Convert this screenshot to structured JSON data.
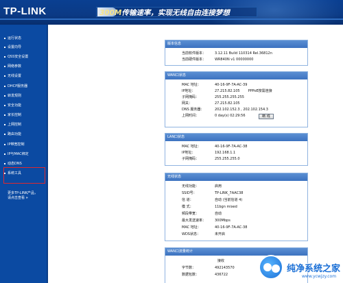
{
  "header": {
    "logo": "TP-LINK",
    "slogan_highlight": "300M",
    "slogan_rest": "传输速率，实现无线自由连接梦想"
  },
  "sidebar": {
    "items": [
      {
        "label": "运行状态"
      },
      {
        "label": "设置向导"
      },
      {
        "label": "QSS安全设置"
      },
      {
        "label": "网络参数"
      },
      {
        "label": "无线设置"
      },
      {
        "label": "DHCP服务器"
      },
      {
        "label": "转发规则"
      },
      {
        "label": "安全功能"
      },
      {
        "label": "家长控制"
      },
      {
        "label": "上网控制"
      },
      {
        "label": "路由功能"
      },
      {
        "label": "IP带宽控制"
      },
      {
        "label": "IP与MAC绑定"
      },
      {
        "label": "动态DNS"
      },
      {
        "label": "系统工具"
      }
    ],
    "more_link_line1": "更多TP-LINK产品，",
    "more_link_line2": "请点击查看",
    "more_link_arrow": "»"
  },
  "panels": {
    "version": {
      "title": "版本信息",
      "rows": [
        {
          "label": "当前软件版本：",
          "value": "3.12.11 Build 110314 Rel.36812n"
        },
        {
          "label": "当前硬件版本：",
          "value": "WR840N v1 00000000"
        }
      ]
    },
    "wan": {
      "title": "WAN口状态",
      "rows": [
        {
          "label": "MAC 地址：",
          "value": "40-16-9F-7A-AC-39",
          "extra": ""
        },
        {
          "label": "IP地址：",
          "value": "27.215.82.105",
          "extra": "PPPoE按需连接"
        },
        {
          "label": "子网掩码：",
          "value": "255.255.255.255",
          "extra": ""
        },
        {
          "label": "网关：",
          "value": "27.215.82.105",
          "extra": ""
        },
        {
          "label": "DNS 服务器：",
          "value": "202.102.152.3 , 202.102.154.3",
          "extra": ""
        },
        {
          "label": "上网时间：",
          "value": "0 day(s) 02:29:56",
          "extra": ""
        }
      ],
      "button": "断 线"
    },
    "lan": {
      "title": "LAN口状态",
      "rows": [
        {
          "label": "MAC 地址：",
          "value": "40-16-9F-7A-AC-38"
        },
        {
          "label": "IP地址：",
          "value": "192.168.1.1"
        },
        {
          "label": "子网掩码：",
          "value": "255.255.255.0"
        }
      ]
    },
    "wireless": {
      "title": "无线状态",
      "rows": [
        {
          "label": "无线功能：",
          "value": "启用"
        },
        {
          "label": "SSID号：",
          "value": "TP-LINK_7AAC38"
        },
        {
          "label": "信 道：",
          "value": "自动 (当前信道 4)"
        },
        {
          "label": "模 式：",
          "value": "11bgn mixed"
        },
        {
          "label": "频段带宽：",
          "value": "自动"
        },
        {
          "label": "最大发送速率：",
          "value": "300Mbps"
        },
        {
          "label": "MAC 地址：",
          "value": "40-16-9F-7A-AC-38"
        },
        {
          "label": "WDS状态：",
          "value": "未开启"
        }
      ]
    },
    "wan_stats": {
      "title": "WAN口流量统计",
      "col_header": "接收",
      "rows": [
        {
          "label": "字节数：",
          "value": "492143570"
        },
        {
          "label": "数据包数：",
          "value": "436722"
        }
      ]
    }
  },
  "watermark": {
    "main": "纯净系统之家",
    "url": "www.ycwjzy.com"
  }
}
